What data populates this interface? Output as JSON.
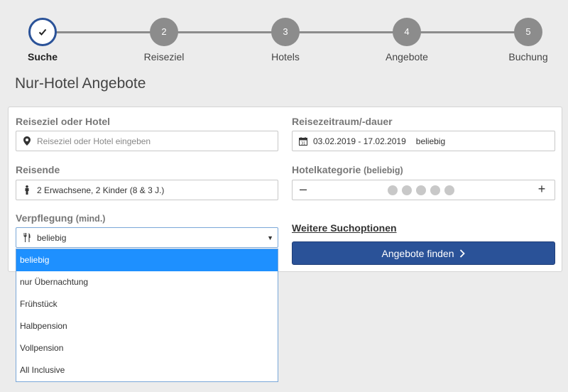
{
  "stepper": {
    "steps": [
      {
        "number": "",
        "label": "Suche",
        "state": "done"
      },
      {
        "number": "2",
        "label": "Reiseziel"
      },
      {
        "number": "3",
        "label": "Hotels"
      },
      {
        "number": "4",
        "label": "Angebote"
      },
      {
        "number": "5",
        "label": "Buchung"
      }
    ]
  },
  "page_title": "Nur-Hotel Angebote",
  "form": {
    "destination": {
      "label": "Reiseziel oder Hotel",
      "placeholder": "Reiseziel oder Hotel eingeben",
      "icon": "map-pin-icon"
    },
    "travel_period": {
      "label": "Reisezeitraum/-dauer",
      "dates": "03.02.2019 - 17.02.2019",
      "duration": "beliebig",
      "icon": "calendar-icon"
    },
    "travelers": {
      "label": "Reisende",
      "value": "2 Erwachsene, 2 Kinder (8 & 3 J.)",
      "icon": "person-icon"
    },
    "hotel_category": {
      "label": "Hotelkategorie",
      "sub": "(beliebig)",
      "minus": "–",
      "plus": "+",
      "stars_selected": 0,
      "stars_total": 5
    },
    "board": {
      "label": "Verpflegung",
      "sub": "(mind.)",
      "value": "beliebig",
      "icon": "cutlery-icon",
      "caret": "▼"
    },
    "more_options": "Weitere Suchoptionen",
    "submit": "Angebote finden"
  },
  "dropdown": {
    "options": [
      "beliebig",
      "nur Übernachtung",
      "Frühstück",
      "Halbpension",
      "Vollpension",
      "All Inclusive"
    ],
    "selected": "beliebig"
  },
  "colors": {
    "accent": "#2a5298",
    "highlight": "#1e90ff",
    "step_inactive": "#8c8c8c",
    "background": "#ececec"
  }
}
